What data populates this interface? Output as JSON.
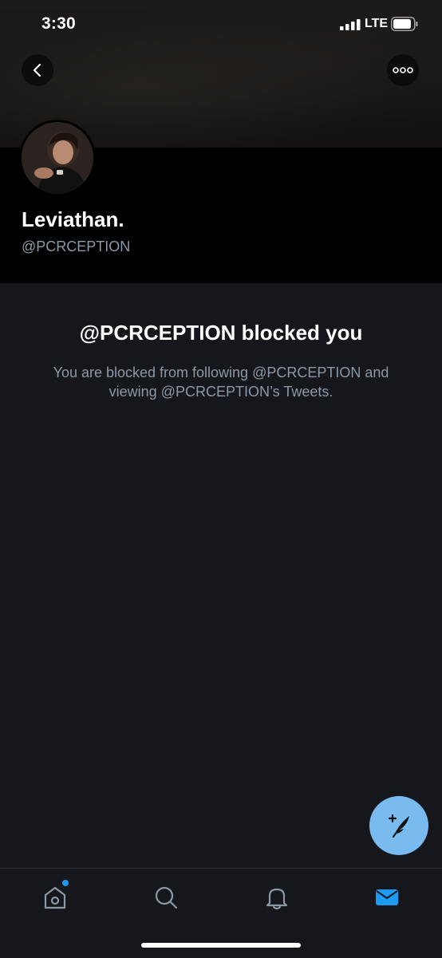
{
  "status_bar": {
    "time": "3:30",
    "network": "LTE"
  },
  "header": {
    "back_icon": "chevron-left-icon",
    "more_icon": "more-horizontal-icon"
  },
  "profile": {
    "avatar": "profile-photo",
    "display_name": "Leviathan.",
    "handle": "@PCRCEPTION"
  },
  "blocked": {
    "title": "@PCRCEPTION blocked you",
    "description": "You are blocked from following @PCRCEPTION and viewing @PCRCEPTION’s Tweets."
  },
  "fab": {
    "icon": "compose-tweet-icon"
  },
  "tabs": [
    {
      "name": "home",
      "icon": "home-icon",
      "has_badge": true
    },
    {
      "name": "search",
      "icon": "search-icon"
    },
    {
      "name": "notifications",
      "icon": "bell-icon"
    },
    {
      "name": "messages",
      "icon": "mail-icon",
      "active": true
    }
  ],
  "colors": {
    "accent": "#1d9bf0",
    "fab": "#79bbef",
    "background": "#15171c",
    "muted_text": "#8b98a5"
  }
}
